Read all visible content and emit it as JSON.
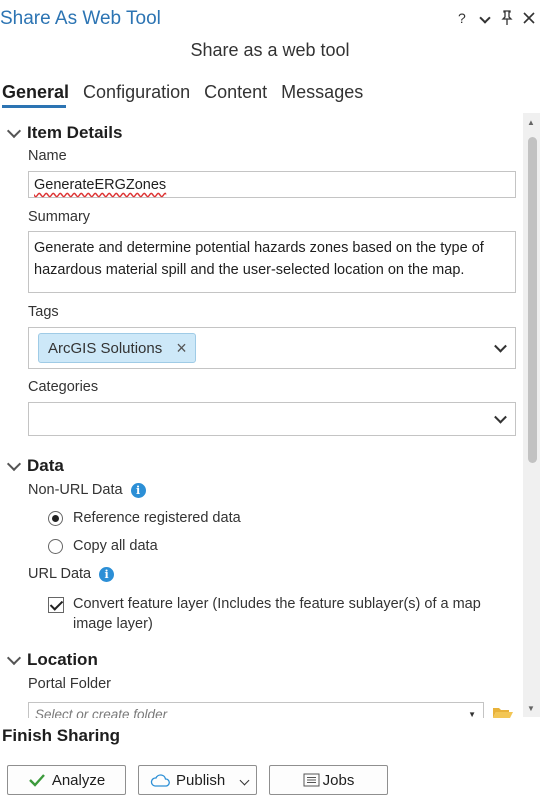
{
  "window": {
    "title": "Share As Web Tool",
    "controls": [
      "?",
      "⌄",
      "📌",
      "✕"
    ]
  },
  "subtitle": "Share as a web tool",
  "tabs": [
    "General",
    "Configuration",
    "Content",
    "Messages"
  ],
  "item_details": {
    "heading": "Item Details",
    "name_label": "Name",
    "name_value": "GenerateERGZones",
    "summary_label": "Summary",
    "summary_value": "Generate and determine potential hazards zones based on the type of hazardous material spill and the user-selected location on the map.",
    "tags_label": "Tags",
    "tags": [
      "ArcGIS Solutions"
    ],
    "categories_label": "Categories",
    "categories_value": ""
  },
  "data": {
    "heading": "Data",
    "non_url_label": "Non-URL Data",
    "options": [
      "Reference registered data",
      "Copy all data"
    ],
    "selected_option": "Reference registered data",
    "url_label": "URL Data",
    "convert_label": "Convert feature layer (Includes the feature sublayer(s) of a map image layer)",
    "convert_checked": true
  },
  "location": {
    "heading": "Location",
    "portal_folder_label": "Portal Folder",
    "folder_placeholder": "Select or create folder"
  },
  "finish": {
    "heading": "Finish Sharing",
    "analyze": "Analyze",
    "publish": "Publish",
    "jobs": "Jobs"
  },
  "colors": {
    "accent": "#2c74b3",
    "info": "#2c8fd6",
    "tag_bg": "#cde8f8",
    "analyze_icon": "#3c9a3c"
  }
}
